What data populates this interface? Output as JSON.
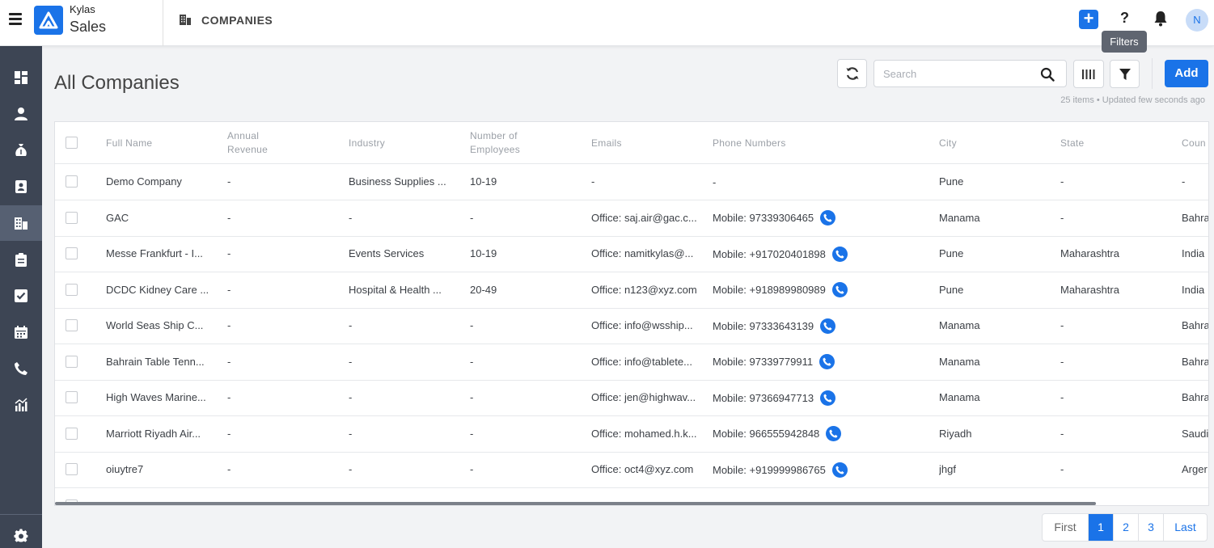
{
  "brand": {
    "line1": "Kylas",
    "line2": "Sales"
  },
  "header": {
    "entity_title": "COMPANIES"
  },
  "user": {
    "initial": "N"
  },
  "page": {
    "title": "All Companies",
    "meta": "25 items • Updated few seconds ago"
  },
  "toolbar": {
    "search_placeholder": "Search",
    "filters_tooltip": "Filters",
    "add_label": "Add"
  },
  "table": {
    "columns": [
      {
        "label": "Full Name",
        "label2": ""
      },
      {
        "label": "Annual",
        "label2": "Revenue"
      },
      {
        "label": "Industry",
        "label2": ""
      },
      {
        "label": "Number of",
        "label2": "Employees"
      },
      {
        "label": "Emails",
        "label2": ""
      },
      {
        "label": "Phone Numbers",
        "label2": ""
      },
      {
        "label": "City",
        "label2": ""
      },
      {
        "label": "State",
        "label2": ""
      },
      {
        "label": "Coun",
        "label2": ""
      }
    ],
    "rows": [
      {
        "name": "Demo Company",
        "revenue": "-",
        "industry": "Business Supplies ...",
        "employees": "10-19",
        "email": "-",
        "phone": "-",
        "has_call": false,
        "city": "Pune",
        "state": "-",
        "country": "-"
      },
      {
        "name": "GAC",
        "revenue": "-",
        "industry": "-",
        "employees": "-",
        "email": "Office: saj.air@gac.c...",
        "phone": "Mobile: 97339306465",
        "has_call": true,
        "city": "Manama",
        "state": "-",
        "country": "Bahra"
      },
      {
        "name": "Messe Frankfurt - I...",
        "revenue": "-",
        "industry": "Events Services",
        "employees": "10-19",
        "email": "Office: namitkylas@...",
        "phone": "Mobile: +917020401898",
        "has_call": true,
        "city": "Pune",
        "state": "Maharashtra",
        "country": "India"
      },
      {
        "name": "DCDC Kidney Care ...",
        "revenue": "-",
        "industry": "Hospital & Health ...",
        "employees": "20-49",
        "email": "Office: n123@xyz.com",
        "phone": "Mobile: +918989980989",
        "has_call": true,
        "city": "Pune",
        "state": "Maharashtra",
        "country": "India"
      },
      {
        "name": "World Seas Ship C...",
        "revenue": "-",
        "industry": "-",
        "employees": "-",
        "email": "Office: info@wsship...",
        "phone": "Mobile: 97333643139",
        "has_call": true,
        "city": "Manama",
        "state": "-",
        "country": "Bahra"
      },
      {
        "name": "Bahrain Table Tenn...",
        "revenue": "-",
        "industry": "-",
        "employees": "-",
        "email": "Office: info@tablete...",
        "phone": "Mobile: 97339779911",
        "has_call": true,
        "city": "Manama",
        "state": "-",
        "country": "Bahra"
      },
      {
        "name": "High Waves Marine...",
        "revenue": "-",
        "industry": "-",
        "employees": "-",
        "email": "Office: jen@highwav...",
        "phone": "Mobile: 97366947713",
        "has_call": true,
        "city": "Manama",
        "state": "-",
        "country": "Bahra"
      },
      {
        "name": "Marriott Riyadh Air...",
        "revenue": "-",
        "industry": "-",
        "employees": "-",
        "email": "Office: mohamed.h.k...",
        "phone": "Mobile: 966555942848",
        "has_call": true,
        "city": "Riyadh",
        "state": "-",
        "country": "Saudi"
      },
      {
        "name": "oiuytre7",
        "revenue": "-",
        "industry": "-",
        "employees": "-",
        "email": "Office: oct4@xyz.com",
        "phone": "Mobile: +919999986765",
        "has_call": true,
        "city": "jhgf",
        "state": "-",
        "country": "Arger"
      }
    ]
  },
  "pagination": {
    "first": "First",
    "pages": [
      "1",
      "2",
      "3"
    ],
    "active": "1",
    "last": "Last"
  }
}
